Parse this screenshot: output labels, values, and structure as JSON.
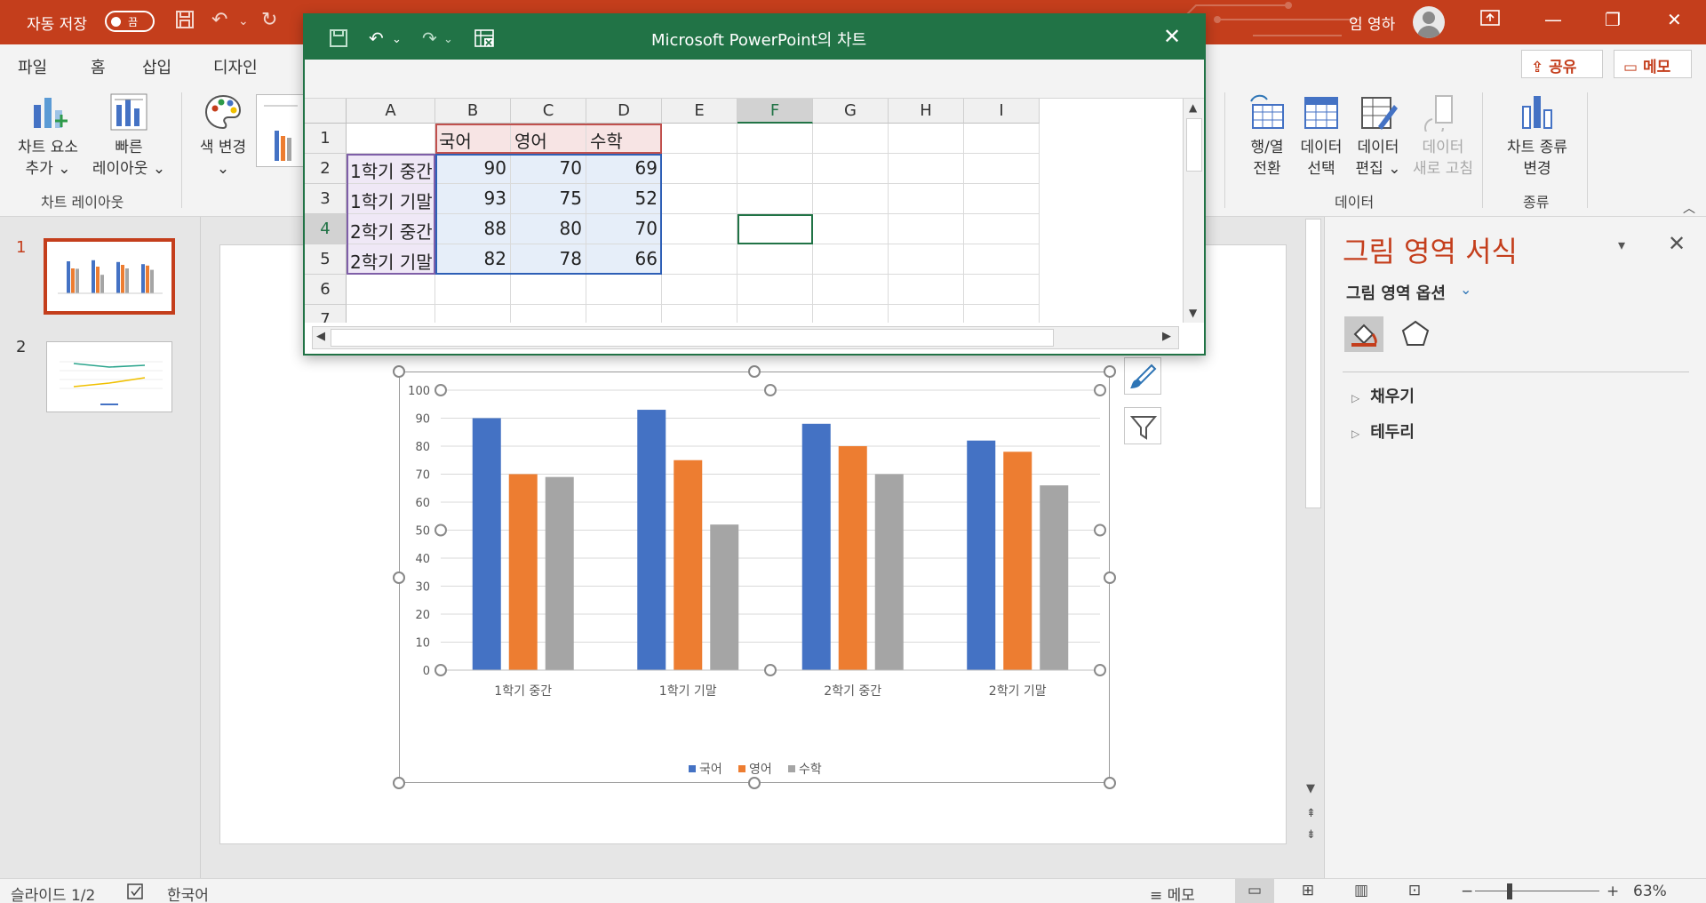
{
  "titlebar": {
    "autosave_label": "자동 저장",
    "autosave_state": "끔",
    "user_name": "임 영하"
  },
  "menu": {
    "tabs": [
      "파일",
      "홈",
      "삽입",
      "디자인"
    ],
    "share_label": "공유",
    "memo_label": "메모"
  },
  "ribbon": {
    "add_element": [
      "차트 요소",
      "추가 ⌄"
    ],
    "quick_layout": [
      "빠른",
      "레이아웃 ⌄"
    ],
    "change_color": [
      "색 변경",
      "⌄"
    ],
    "group_chart_layout": "차트 레이아웃",
    "switch_row_col": [
      "행/열",
      "전환"
    ],
    "select_data": [
      "데이터",
      "선택"
    ],
    "edit_data": [
      "데이터",
      "편집 ⌄"
    ],
    "refresh_data": [
      "데이터",
      "새로 고침"
    ],
    "group_data": "데이터",
    "change_type": [
      "차트 종류",
      "변경"
    ],
    "group_type": "종류"
  },
  "thumbnails": [
    {
      "number": "1",
      "active": true
    },
    {
      "number": "2",
      "active": false
    }
  ],
  "excel": {
    "title": "Microsoft PowerPoint의 차트",
    "columns": [
      "A",
      "B",
      "C",
      "D",
      "E",
      "F",
      "G",
      "H",
      "I"
    ],
    "rows": [
      "1",
      "2",
      "3",
      "4",
      "5",
      "6",
      "7"
    ],
    "selected_column": "F",
    "selected_row": "4",
    "cells": {
      "header": [
        "",
        "국어",
        "영어",
        "수학"
      ],
      "data": [
        [
          "1학기 중간",
          "90",
          "70",
          "69"
        ],
        [
          "1학기 기말",
          "93",
          "75",
          "52"
        ],
        [
          "2학기 중간",
          "88",
          "80",
          "70"
        ],
        [
          "2학기 기말",
          "82",
          "78",
          "66"
        ]
      ]
    }
  },
  "chart_data": {
    "type": "bar",
    "categories": [
      "1학기 중간",
      "1학기 기말",
      "2학기 중간",
      "2학기 기말"
    ],
    "series": [
      {
        "name": "국어",
        "values": [
          90,
          93,
          88,
          82
        ],
        "color": "#4472c4"
      },
      {
        "name": "영어",
        "values": [
          70,
          75,
          80,
          78
        ],
        "color": "#ed7d31"
      },
      {
        "name": "수학",
        "values": [
          69,
          52,
          70,
          66
        ],
        "color": "#a5a5a5"
      }
    ],
    "ylim": [
      0,
      100
    ],
    "yticks": [
      0,
      10,
      20,
      30,
      40,
      50,
      60,
      70,
      80,
      90,
      100
    ],
    "grid": true,
    "legend": "bottom"
  },
  "pane": {
    "title": "그림 영역 서식",
    "options_label": "그림 영역 옵션",
    "sections": [
      "채우기",
      "테두리"
    ]
  },
  "status": {
    "slide_info": "슬라이드 1/2",
    "language": "한국어",
    "notes_label": "메모",
    "zoom": "63%"
  }
}
